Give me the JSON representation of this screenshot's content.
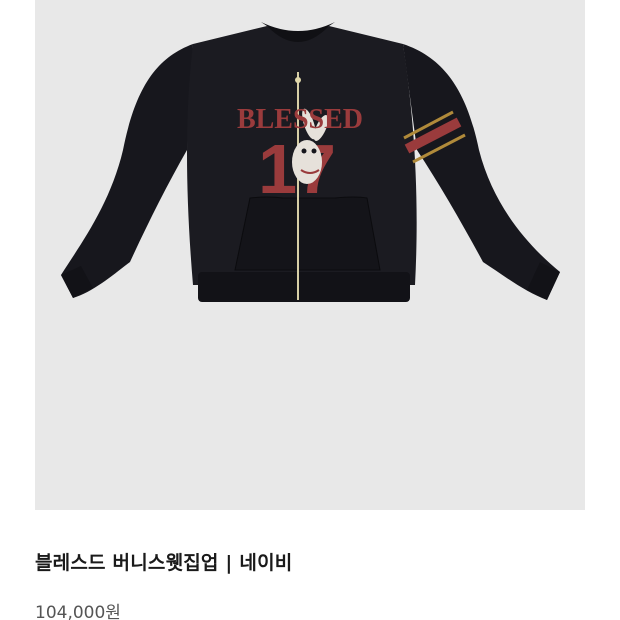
{
  "product": {
    "title": "블레스드 버니스웻집업 | 네이비",
    "price": "104,000원",
    "image": {
      "print_text": "BLESSED",
      "print_number": "17",
      "colors": {
        "background": "#e8e8e8",
        "jacket": "#17171d",
        "print": "#9a3b3c",
        "stripe_gold": "#b08a3a"
      }
    }
  }
}
